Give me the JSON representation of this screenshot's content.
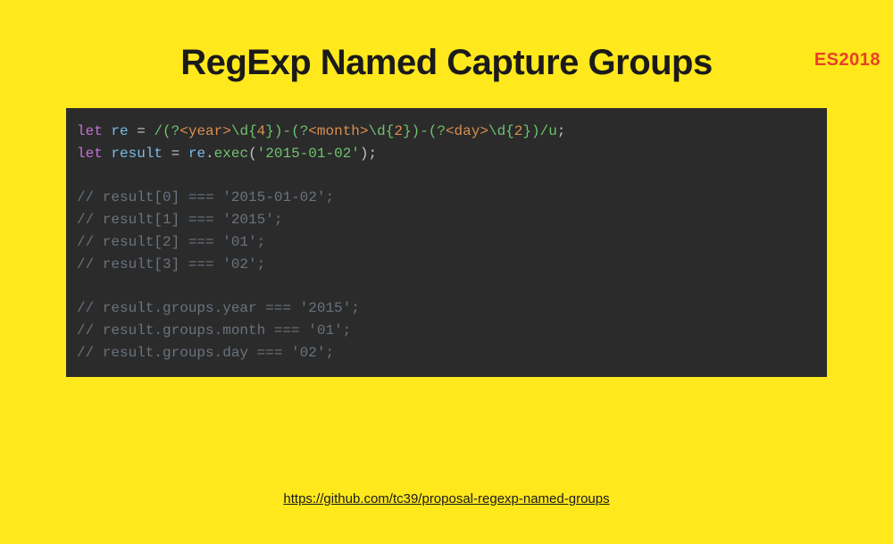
{
  "badge": "ES2018",
  "title": "RegExp Named Capture Groups",
  "code": {
    "l1": {
      "kw": "let",
      "var": "re",
      "eq": " = ",
      "rx1": "/(?",
      "g1": "<year>",
      "rx2": "\\d{",
      "n1": "4",
      "rx3": "})-(?",
      "g2": "<month>",
      "rx4": "\\d{",
      "n2": "2",
      "rx5": "})-(?",
      "g3": "<day>",
      "rx6": "\\d{",
      "n3": "2",
      "rx7": "})/u",
      "semi": ";"
    },
    "l2": {
      "kw": "let",
      "var": "result",
      "eq": " = ",
      "obj": "re",
      "dot": ".",
      "method": "exec",
      "lp": "(",
      "str": "'2015-01-02'",
      "rp": ")",
      "semi": ";"
    },
    "c1": "// result[0] === '2015-01-02';",
    "c2": "// result[1] === '2015';",
    "c3": "// result[2] === '01';",
    "c4": "// result[3] === '02';",
    "c5": "// result.groups.year === '2015';",
    "c6": "// result.groups.month === '01';",
    "c7": "// result.groups.day === '02';"
  },
  "link": "https://github.com/tc39/proposal-regexp-named-groups"
}
